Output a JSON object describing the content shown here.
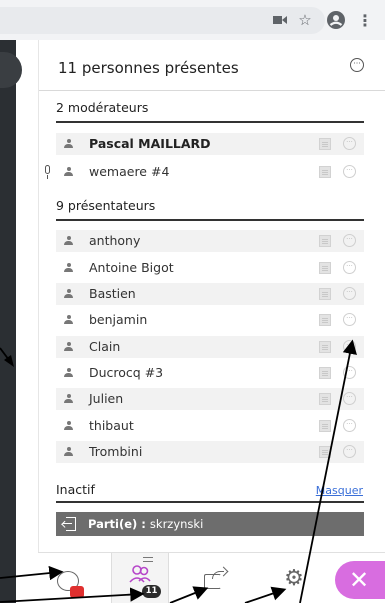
{
  "browser": {
    "icons": [
      "camera-icon",
      "star-icon",
      "account-icon",
      "menu-icon"
    ]
  },
  "panel": {
    "title": "11 personnes présentes",
    "moderators_heading": "2 modérateurs",
    "moderators": [
      {
        "name": "Pascal MAILLARD",
        "bold": true
      },
      {
        "name": "wemaere #4",
        "bold": false,
        "mic": true
      }
    ],
    "presenters_heading": "9 présentateurs",
    "presenters": [
      {
        "name": "anthony"
      },
      {
        "name": "Antoine Bigot"
      },
      {
        "name": "Bastien"
      },
      {
        "name": "benjamin"
      },
      {
        "name": "Clain"
      },
      {
        "name": "Ducrocq #3"
      },
      {
        "name": "Julien"
      },
      {
        "name": "thibaut"
      },
      {
        "name": "Trombini"
      }
    ],
    "inactive_heading": "Inactif",
    "hide_link": "Masquer",
    "left_label": "Parti(e) :",
    "left_name": "skrzynski"
  },
  "toolbar": {
    "participants_badge": "11",
    "accent_color": "#d86de0",
    "chat_badge_color": "#e0302f"
  }
}
